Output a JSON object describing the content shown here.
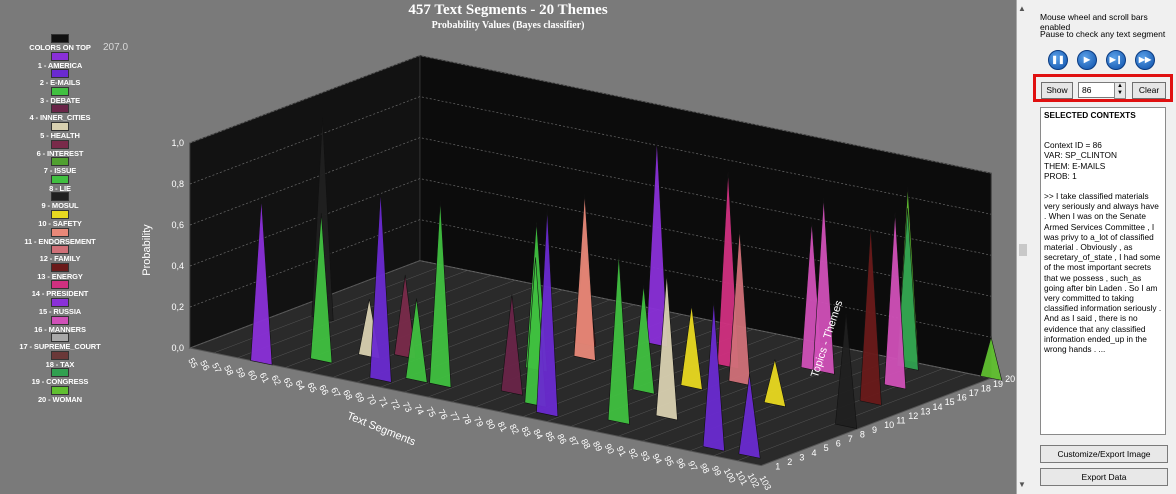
{
  "title": "457 Text Segments -  20 Themes",
  "subtitle": "Probability Values (Bayes classifier)",
  "zoom_readout": "207.0",
  "legend": [
    {
      "label": "COLORS ON TOP",
      "color": "#101010"
    },
    {
      "label": "1 - AMERICA",
      "color": "#8a30d8"
    },
    {
      "label": "2 - E-MAILS",
      "color": "#6a2ad0"
    },
    {
      "label": "3 - DEBATE",
      "color": "#40c040"
    },
    {
      "label": "4 - INNER_CITIES",
      "color": "#6a2448"
    },
    {
      "label": "5 - HEALTH",
      "color": "#d8d0b0"
    },
    {
      "label": "6 - INTEREST",
      "color": "#7a2a4a"
    },
    {
      "label": "7 - ISSUE",
      "color": "#50a030"
    },
    {
      "label": "8 - LIE",
      "color": "#40c040"
    },
    {
      "label": "9 - MOSUL",
      "color": "#202020"
    },
    {
      "label": "10 - SAFETY",
      "color": "#e8d820"
    },
    {
      "label": "11 - ENDORSEMENT",
      "color": "#e88878"
    },
    {
      "label": "12 - FAMILY",
      "color": "#d07078"
    },
    {
      "label": "13 - ENERGY",
      "color": "#6a1a1a"
    },
    {
      "label": "14 - PRESIDENT",
      "color": "#d03080"
    },
    {
      "label": "15 - RUSSIA",
      "color": "#8a30d8"
    },
    {
      "label": "16 - MANNERS",
      "color": "#d050b8"
    },
    {
      "label": "17 - SUPREME_COURT",
      "color": "#a8a8a8"
    },
    {
      "label": "18 - TAX",
      "color": "#6a3838"
    },
    {
      "label": "19 - CONGRESS",
      "color": "#30a050"
    },
    {
      "label": "20 - WOMAN",
      "color": "#60c030"
    }
  ],
  "chart_data": {
    "type": "3d-surface",
    "title": "457 Text Segments -  20 Themes",
    "subtitle": "Probability Values (Bayes classifier)",
    "xlabel": "Text Segments",
    "ylabel": "Probability",
    "zlabel": "Topics - Themes",
    "ylim": [
      0,
      1.0
    ],
    "y_ticks": [
      "0,0",
      "0,2",
      "0,4",
      "0,6",
      "0,8",
      "1,0"
    ],
    "x_ticks": [
      "55",
      "56",
      "57",
      "58",
      "59",
      "60",
      "61",
      "62",
      "63",
      "64",
      "65",
      "66",
      "67",
      "68",
      "69",
      "70",
      "71",
      "72",
      "73",
      "74",
      "75",
      "76",
      "77",
      "78",
      "79",
      "80",
      "81",
      "82",
      "83",
      "84",
      "85",
      "86",
      "87",
      "88",
      "89",
      "90",
      "91",
      "92",
      "93",
      "94",
      "95",
      "96",
      "97",
      "98",
      "99",
      "100",
      "101",
      "102",
      "103"
    ],
    "z_ticks": [
      "1",
      "2",
      "3",
      "4",
      "5",
      "6",
      "7",
      "8",
      "9",
      "10",
      "11",
      "12",
      "13",
      "14",
      "15",
      "16",
      "17",
      "18",
      "19",
      "20"
    ],
    "peaks": [
      {
        "segment": 58,
        "theme": 9,
        "prob": 0.98
      },
      {
        "segment": 61,
        "theme": 1,
        "prob": 0.8
      },
      {
        "segment": 64,
        "theme": 3,
        "prob": 0.72
      },
      {
        "segment": 66,
        "theme": 5,
        "prob": 0.28
      },
      {
        "segment": 68,
        "theme": 6,
        "prob": 0.4
      },
      {
        "segment": 70,
        "theme": 2,
        "prob": 0.92
      },
      {
        "segment": 72,
        "theme": 3,
        "prob": 0.4
      },
      {
        "segment": 74,
        "theme": 3,
        "prob": 0.9
      },
      {
        "segment": 76,
        "theme": 13,
        "prob": 0.5
      },
      {
        "segment": 77,
        "theme": 8,
        "prob": 0.72
      },
      {
        "segment": 78,
        "theme": 11,
        "prob": 0.8
      },
      {
        "segment": 79,
        "theme": 4,
        "prob": 0.48
      },
      {
        "segment": 80,
        "theme": 15,
        "prob": 1.0
      },
      {
        "segment": 82,
        "theme": 3,
        "prob": 0.72
      },
      {
        "segment": 84,
        "theme": 2,
        "prob": 1.0
      },
      {
        "segment": 86,
        "theme": 8,
        "prob": 0.52
      },
      {
        "segment": 87,
        "theme": 14,
        "prob": 0.95
      },
      {
        "segment": 88,
        "theme": 10,
        "prob": 0.4
      },
      {
        "segment": 89,
        "theme": 3,
        "prob": 0.82
      },
      {
        "segment": 90,
        "theme": 12,
        "prob": 0.75
      },
      {
        "segment": 91,
        "theme": 5,
        "prob": 0.7
      },
      {
        "segment": 92,
        "theme": 16,
        "prob": 0.72
      },
      {
        "segment": 93,
        "theme": 16,
        "prob": 0.85
      },
      {
        "segment": 95,
        "theme": 10,
        "prob": 0.22
      },
      {
        "segment": 96,
        "theme": 20,
        "prob": 0.85
      },
      {
        "segment": 97,
        "theme": 19,
        "prob": 0.78
      },
      {
        "segment": 98,
        "theme": 2,
        "prob": 0.72
      },
      {
        "segment": 99,
        "theme": 16,
        "prob": 0.85
      },
      {
        "segment": 100,
        "theme": 13,
        "prob": 0.86
      },
      {
        "segment": 101,
        "theme": 2,
        "prob": 0.4
      },
      {
        "segment": 102,
        "theme": 9,
        "prob": 0.55
      },
      {
        "segment": 103,
        "theme": 20,
        "prob": 0.2
      }
    ]
  },
  "panel": {
    "hint1": "Mouse wheel and scroll bars enabled",
    "hint2": "Pause to check any text segment",
    "media": [
      "pause-icon",
      "play-icon",
      "step-forward-icon",
      "fast-forward-icon"
    ],
    "show_label": "Show",
    "spin_value": "86",
    "clear_label": "Clear",
    "contexts_title": "SELECTED CONTEXTS",
    "context_id": "Context ID =  86",
    "context_var": "VAR: SP_CLINTON",
    "context_them": "THEM: E-MAILS",
    "context_prob": "PROB:  1",
    "context_text": ">> I take classified materials very seriously and always have .  When I was on the Senate Armed Services Committee ,  I was privy to a_lot of classified material .  Obviously ,  as secretary_of_state ,  I had some of the most important secrets that we possess ,  such_as going after bin Laden .  So I am very committed to taking classified information seriously .  And as I said ,  there is no evidence that any classified information ended_up in the wrong hands . ...",
    "customize_label": "Customize/Export Image",
    "export_label": "Export Data"
  }
}
